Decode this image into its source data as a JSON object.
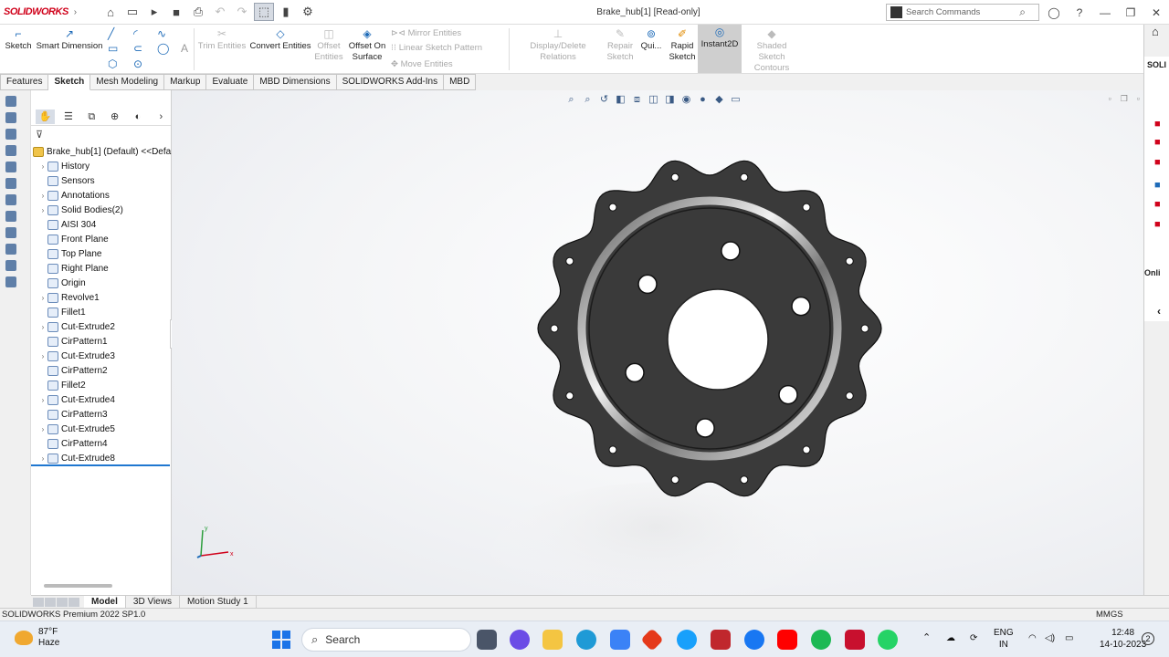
{
  "app": {
    "logo": "SOLIDWORKS",
    "window_title": "Brake_hub[1] [Read-only]"
  },
  "search_commands": {
    "placeholder": "Search Commands"
  },
  "ribbon": {
    "sketch": "Sketch",
    "smart_dimension": "Smart Dimension",
    "trim_entities": "Trim Entities",
    "convert_entities": "Convert Entities",
    "offset_entities_1": "Offset",
    "offset_entities_2": "Entities",
    "offset_on_surface_1": "Offset On",
    "offset_on_surface_2": "Surface",
    "mirror_entities": "Mirror Entities",
    "linear_sketch_pattern": "Linear Sketch Pattern",
    "move_entities": "Move Entities",
    "display_delete_relations": "Display/Delete Relations",
    "repair_sketch_1": "Repair",
    "repair_sketch_2": "Sketch",
    "quick_snaps": "Qui...",
    "rapid_sketch_1": "Rapid",
    "rapid_sketch_2": "Sketch",
    "instant2d": "Instant2D",
    "shaded_sketch_1": "Shaded Sketch",
    "shaded_sketch_2": "Contours"
  },
  "tabs": [
    "Features",
    "Sketch",
    "Mesh Modeling",
    "Markup",
    "Evaluate",
    "MBD Dimensions",
    "SOLIDWORKS Add-Ins",
    "MBD"
  ],
  "active_tab": "Sketch",
  "feature_tree": {
    "root": "Brake_hub[1] (Default) <<Defa",
    "items": [
      {
        "label": "History",
        "expandable": true
      },
      {
        "label": "Sensors",
        "expandable": false
      },
      {
        "label": "Annotations",
        "expandable": true
      },
      {
        "label": "Solid Bodies(2)",
        "expandable": true
      },
      {
        "label": "AISI 304",
        "expandable": false
      },
      {
        "label": "Front Plane",
        "expandable": false
      },
      {
        "label": "Top Plane",
        "expandable": false
      },
      {
        "label": "Right Plane",
        "expandable": false
      },
      {
        "label": "Origin",
        "expandable": false
      },
      {
        "label": "Revolve1",
        "expandable": true
      },
      {
        "label": "Fillet1",
        "expandable": false
      },
      {
        "label": "Cut-Extrude2",
        "expandable": true
      },
      {
        "label": "CirPattern1",
        "expandable": false
      },
      {
        "label": "Cut-Extrude3",
        "expandable": true
      },
      {
        "label": "CirPattern2",
        "expandable": false
      },
      {
        "label": "Fillet2",
        "expandable": false
      },
      {
        "label": "Cut-Extrude4",
        "expandable": true
      },
      {
        "label": "CirPattern3",
        "expandable": false
      },
      {
        "label": "Cut-Extrude5",
        "expandable": true
      },
      {
        "label": "CirPattern4",
        "expandable": false
      },
      {
        "label": "Cut-Extrude8",
        "expandable": true
      }
    ]
  },
  "model_tabs": [
    "Model",
    "3D Views",
    "Motion Study 1"
  ],
  "active_model_tab": "Model",
  "status": {
    "left": "SOLIDWORKS Premium 2022 SP1.0",
    "units": "MMGS"
  },
  "task_pane": {
    "label1": "SOLI",
    "label2": "Onli"
  },
  "taskbar": {
    "temp": "87°F",
    "weather": "Haze",
    "search": "Search",
    "lang1": "ENG",
    "lang2": "IN",
    "time": "12:48",
    "date": "14-10-2023",
    "notifications": "2"
  },
  "colors": {
    "accent": "#1f77d0",
    "part": "#3a3a3a",
    "active_cmd": "#cfcfcf"
  }
}
